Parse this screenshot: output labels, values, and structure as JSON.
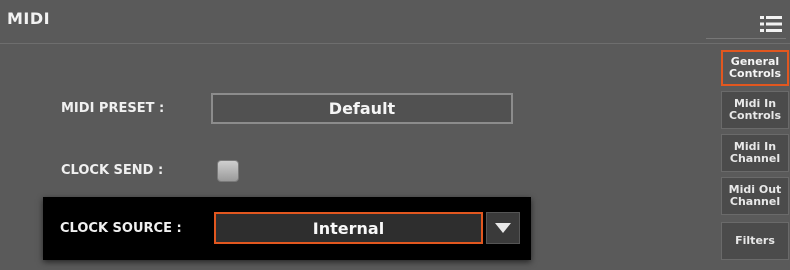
{
  "header": {
    "title": "MIDI",
    "menu_icon": "list-menu-icon"
  },
  "form": {
    "midi_preset_label": "MIDI PRESET :",
    "midi_preset_value": "Default",
    "clock_send_label": "CLOCK SEND :",
    "clock_send_checked": false,
    "clock_source_label": "CLOCK SOURCE :",
    "clock_source_value": "Internal"
  },
  "tabs": [
    {
      "label": "General\nControls",
      "active": true
    },
    {
      "label": "Midi In\nControls",
      "active": false
    },
    {
      "label": "Midi In\nChannel",
      "active": false
    },
    {
      "label": "Midi Out\nChannel",
      "active": false
    },
    {
      "label": "Filters",
      "active": false
    }
  ],
  "colors": {
    "accent": "#e2571f",
    "background": "#5a5a5a",
    "popup": "#000000"
  }
}
